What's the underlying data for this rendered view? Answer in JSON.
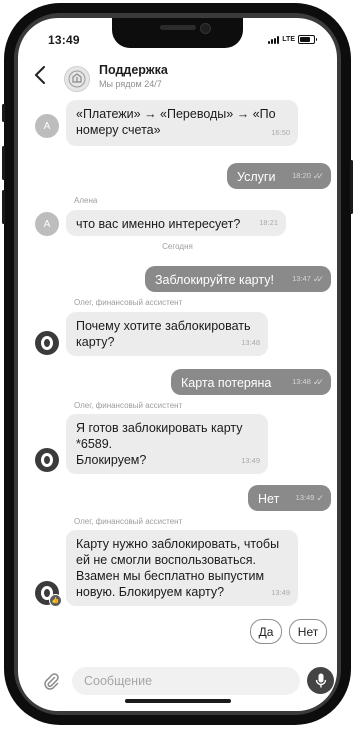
{
  "status_bar": {
    "time": "13:49",
    "network": "LTE"
  },
  "header": {
    "title": "Поддержка",
    "subtitle": "Мы рядом 24/7",
    "back_icon": "chevron-left-icon"
  },
  "messages": [
    {
      "from": "user",
      "avatar": "А",
      "text": "«Платежи» → «Переводы» → «По номеру счета»",
      "time": "16:50"
    },
    {
      "from": "me",
      "text": "Услуги",
      "time": "18:20"
    },
    {
      "from": "user",
      "sender": "Алена",
      "avatar": "А",
      "text": "что вас именно интересует?",
      "time": "18:21"
    },
    {
      "day_divider": "Сегодня"
    },
    {
      "from": "me",
      "text": "Заблокируйте карту!",
      "time": "13:47"
    },
    {
      "from": "bot",
      "sender": "Олег, финансовый ассистент",
      "text": "Почему хотите заблокировать карту?",
      "time": "13:48"
    },
    {
      "from": "me",
      "text": "Карта потеряна",
      "time": "13:48"
    },
    {
      "from": "bot",
      "sender": "Олег, финансовый ассистент",
      "text": "Я готов заблокировать карту *6589.\nБлокируем?",
      "time": "13:49"
    },
    {
      "from": "me",
      "text": "Нет",
      "time": "13:49"
    },
    {
      "from": "bot",
      "sender": "Олег, финансовый ассистент",
      "text": "Карту нужно заблокировать, чтобы ей не смогли воспользоваться. Взамен мы бесплатно выпустим новую. Блокируем карту?",
      "time": "13:49"
    }
  ],
  "quick_replies": [
    "Да",
    "Нет"
  ],
  "composer": {
    "placeholder": "Сообщение",
    "attach_icon": "paperclip-icon",
    "mic_icon": "microphone-icon"
  }
}
